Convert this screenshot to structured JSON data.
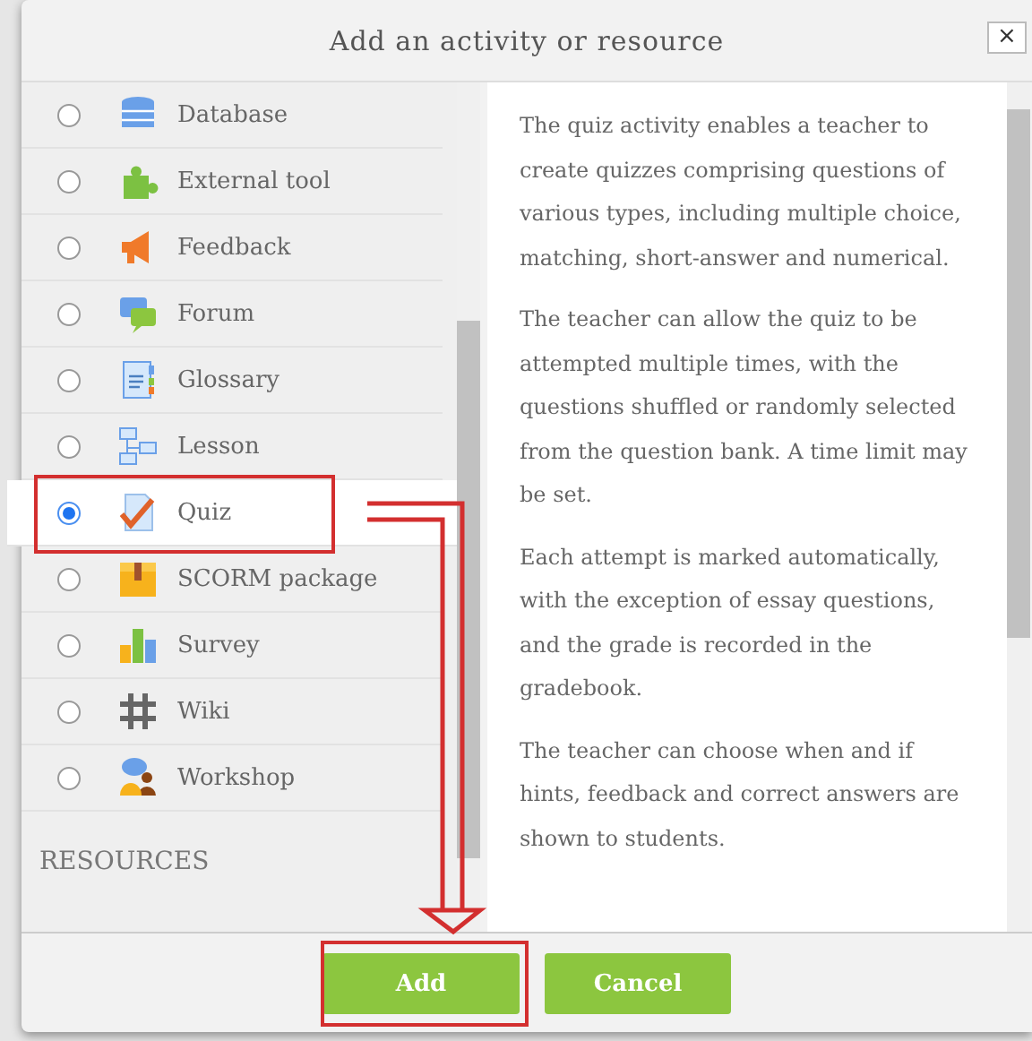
{
  "dialog": {
    "title": "Add an activity or resource",
    "close": "×"
  },
  "activities": [
    {
      "name": "Database",
      "selected": false
    },
    {
      "name": "External tool",
      "selected": false
    },
    {
      "name": "Feedback",
      "selected": false
    },
    {
      "name": "Forum",
      "selected": false
    },
    {
      "name": "Glossary",
      "selected": false
    },
    {
      "name": "Lesson",
      "selected": false
    },
    {
      "name": "Quiz",
      "selected": true
    },
    {
      "name": "SCORM package",
      "selected": false
    },
    {
      "name": "Survey",
      "selected": false
    },
    {
      "name": "Wiki",
      "selected": false
    },
    {
      "name": "Workshop",
      "selected": false
    }
  ],
  "section_heading": "RESOURCES",
  "description": [
    "The quiz activity enables a teacher to create quizzes comprising questions of various types, including multiple choice, matching, short-answer and numerical.",
    "The teacher can allow the quiz to be attempted multiple times, with the questions shuffled or randomly selected from the question bank. A time limit may be set.",
    "Each attempt is marked automatically, with the exception of essay questions, and the grade is recorded in the gradebook.",
    "The teacher can choose when and if hints, feedback and correct answers are shown to students."
  ],
  "buttons": [
    "Add",
    "Cancel"
  ]
}
